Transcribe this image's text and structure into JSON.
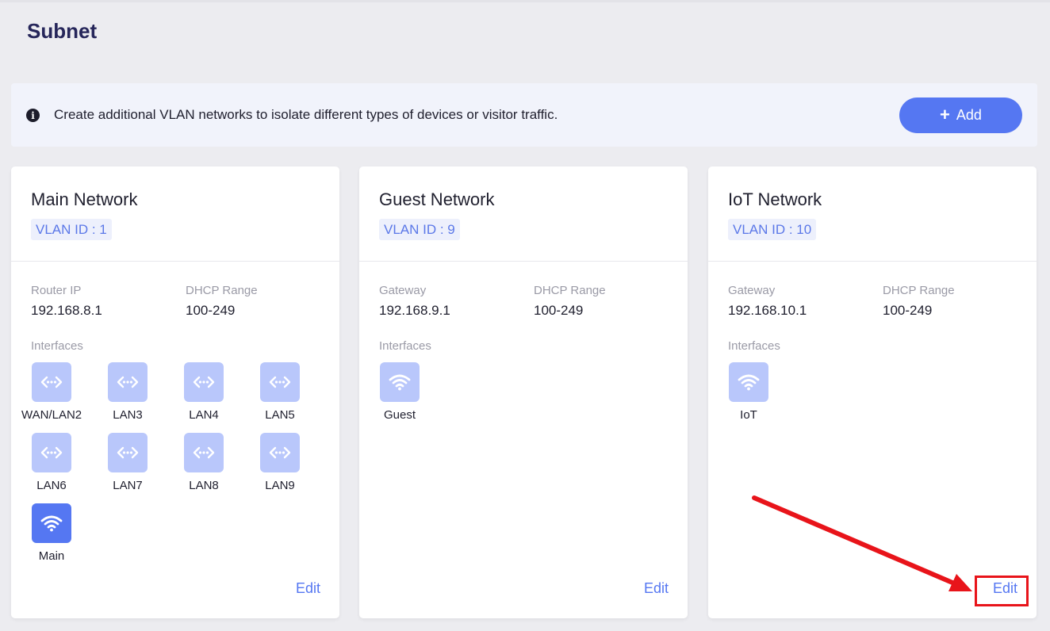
{
  "page": {
    "title": "Subnet"
  },
  "banner": {
    "info_icon": "info-icon",
    "text": "Create additional VLAN networks to isolate different types of devices or visitor traffic.",
    "add_label": "Add",
    "add_icon": "plus-icon"
  },
  "cards": [
    {
      "title": "Main Network",
      "vlan": "VLAN ID : 1",
      "ip_label": "Router IP",
      "ip_value": "192.168.8.1",
      "dhcp_label": "DHCP Range",
      "dhcp_value": "100-249",
      "interfaces_label": "Interfaces",
      "interfaces": [
        {
          "label": "WAN/LAN2",
          "icon": "ethernet-icon",
          "active": false
        },
        {
          "label": "LAN3",
          "icon": "ethernet-icon",
          "active": false
        },
        {
          "label": "LAN4",
          "icon": "ethernet-icon",
          "active": false
        },
        {
          "label": "LAN5",
          "icon": "ethernet-icon",
          "active": false
        },
        {
          "label": "LAN6",
          "icon": "ethernet-icon",
          "active": false
        },
        {
          "label": "LAN7",
          "icon": "ethernet-icon",
          "active": false
        },
        {
          "label": "LAN8",
          "icon": "ethernet-icon",
          "active": false
        },
        {
          "label": "LAN9",
          "icon": "ethernet-icon",
          "active": false
        },
        {
          "label": "Main",
          "icon": "wifi-icon",
          "active": true
        }
      ],
      "edit_label": "Edit"
    },
    {
      "title": "Guest Network",
      "vlan": "VLAN ID : 9",
      "ip_label": "Gateway",
      "ip_value": "192.168.9.1",
      "dhcp_label": "DHCP Range",
      "dhcp_value": "100-249",
      "interfaces_label": "Interfaces",
      "interfaces": [
        {
          "label": "Guest",
          "icon": "wifi-icon",
          "active": false
        }
      ],
      "edit_label": "Edit"
    },
    {
      "title": "IoT Network",
      "vlan": "VLAN ID : 10",
      "ip_label": "Gateway",
      "ip_value": "192.168.10.1",
      "dhcp_label": "DHCP Range",
      "dhcp_value": "100-249",
      "interfaces_label": "Interfaces",
      "interfaces": [
        {
          "label": "IoT",
          "icon": "wifi-icon",
          "active": false
        }
      ],
      "edit_label": "Edit"
    }
  ],
  "colors": {
    "accent": "#5577f2",
    "icon_inactive": "#b9c7fb",
    "annotation": "#e8141a"
  }
}
